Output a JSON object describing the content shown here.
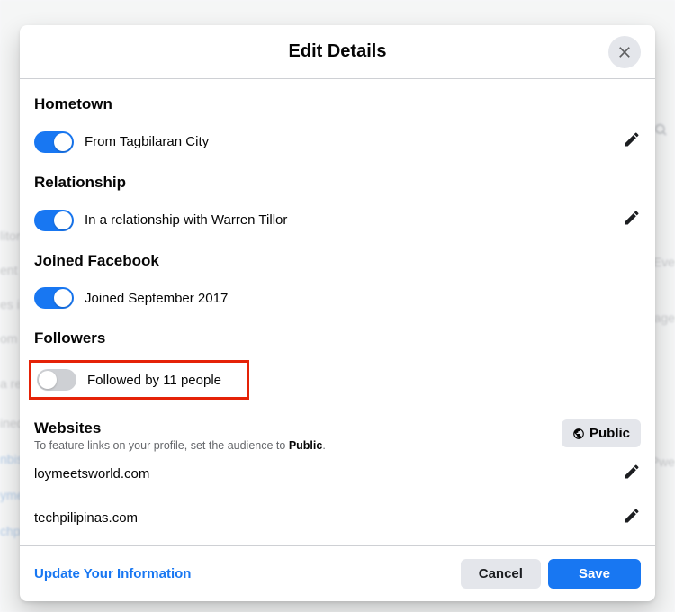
{
  "modal": {
    "title": "Edit Details",
    "sections": {
      "hometown": {
        "label": "Hometown",
        "text": "From Tagbilaran City",
        "toggle_on": true
      },
      "relationship": {
        "label": "Relationship",
        "text": "In a relationship with Warren Tillor",
        "toggle_on": true
      },
      "joined": {
        "label": "Joined Facebook",
        "text": "Joined September 2017",
        "toggle_on": true
      },
      "followers": {
        "label": "Followers",
        "text": "Followed by 11 people",
        "toggle_on": false
      },
      "websites": {
        "label": "Websites",
        "sub_pre": "To feature links on your profile, set the audience to ",
        "sub_bold": "Public",
        "sub_post": ".",
        "public_btn": "Public",
        "items": [
          "loymeetsworld.com",
          "techpilipinas.com"
        ]
      }
    },
    "footer": {
      "update_link": "Update Your Information",
      "cancel": "Cancel",
      "save": "Save"
    }
  },
  "backdrop_fragments": [
    "litor",
    "ent",
    "es i",
    "om",
    "a re",
    "ined",
    "nbis",
    "yme",
    "chpi",
    "Eve",
    "age",
    "Pwe"
  ]
}
